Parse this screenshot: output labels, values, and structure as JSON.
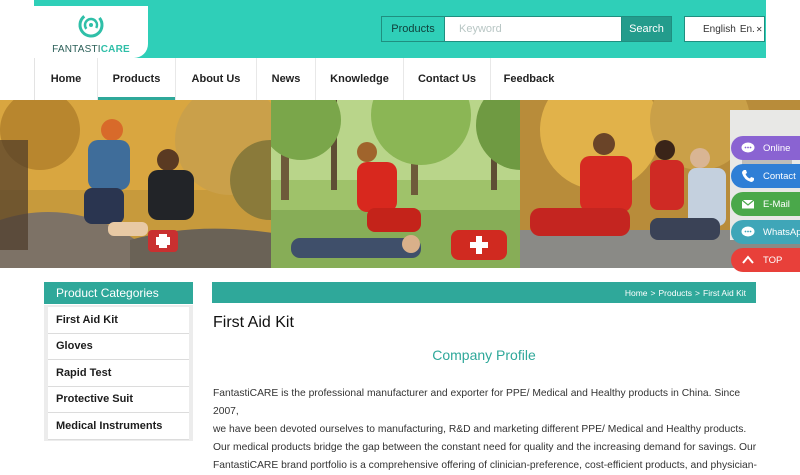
{
  "brand": {
    "logo_prefix": "FANTASTI",
    "logo_suffix": "CARE"
  },
  "search": {
    "category": "Products",
    "placeholder": "Keyword",
    "button": "Search"
  },
  "language": {
    "label": "English",
    "selected": "En."
  },
  "nav": [
    "Home",
    "Products",
    "About Us",
    "News",
    "Knowledge",
    "Contact Us",
    "Feedback"
  ],
  "nav_active": "Products",
  "floating": [
    {
      "label": "Online",
      "color": "#8a63d2",
      "icon": "chat-icon"
    },
    {
      "label": "Contact",
      "color": "#2f7fd6",
      "icon": "phone-icon"
    },
    {
      "label": "E-Mail",
      "color": "#4aa84a",
      "icon": "mail-icon"
    },
    {
      "label": "WhatsApp",
      "color": "#3fa6b8",
      "icon": "whatsapp-icon"
    },
    {
      "label": "TOP",
      "color": "#e8403a",
      "icon": "chevron-up-icon"
    }
  ],
  "sidebar": {
    "title": "Product Categories",
    "items": [
      "First Aid Kit",
      "Gloves",
      "Rapid Test",
      "Protective Suit",
      "Medical Instruments"
    ]
  },
  "breadcrumb": [
    "Home",
    ">",
    "Products",
    ">",
    "First Aid Kit"
  ],
  "page_title": "First Aid Kit",
  "section_title": "Company Profile",
  "paragraph": [
    "FantastiCARE is the professional manufacturer and exporter for PPE/ Medical and Healthy products in China. Since 2007,",
    "we have been devoted ourselves to manufacturing, R&D and marketing different PPE/ Medical and Healthy products.",
    "Our medical products bridge the gap between the constant need for quality and the increasing demand for savings. Our",
    "FantastiCARE brand portfolio is a comprehensive offering of clinician-preference, cost-efficient products, and physician-"
  ],
  "colors": {
    "teal": "#2fcfb8",
    "teal_dark": "#2fa89a"
  }
}
